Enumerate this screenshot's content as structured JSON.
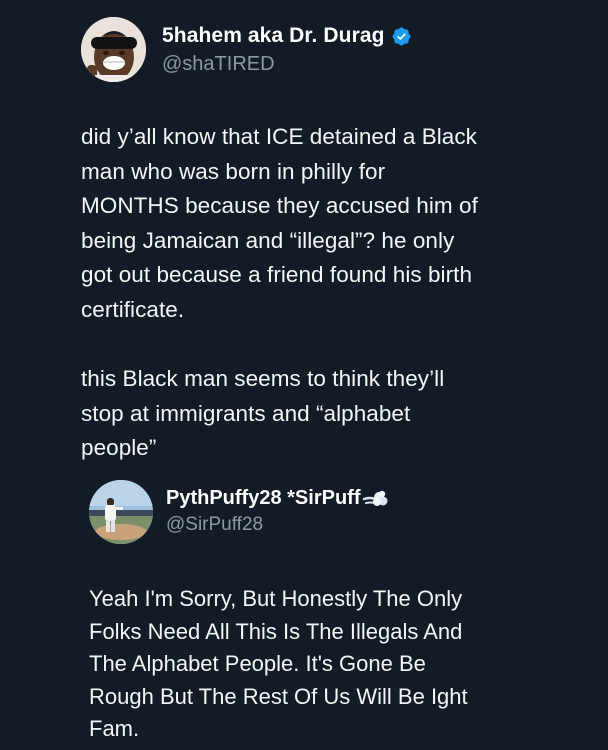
{
  "main_tweet": {
    "author_name": "5hahem aka Dr. Durag",
    "author_handle": "@shaTIRED",
    "verified": true,
    "paragraphs": [
      "did y’all know that ICE detained a Black\nman who was born in philly for\nMONTHS because they accused him of\nbeing Jamaican and “illegal”? he only\ngot out because a friend found his birth\ncertificate.",
      "this Black man seems to think they’ll\nstop at immigrants and “alphabet\npeople”"
    ]
  },
  "quoted_tweet": {
    "author_name": "PythPuffy28 *SirPuff",
    "author_handle": "@SirPuff28",
    "name_emoji": "dashing-away-icon",
    "text": "Yeah I'm Sorry, But Honestly The Only\nFolks Need All This Is The Illegals And\nThe Alphabet People. It's Gone Be\nRough But The Rest Of Us Will Be Ight\nFam."
  },
  "colors": {
    "background": "#131c26",
    "text": "#f4f6f8",
    "secondary_text": "#8b98a5",
    "verified_badge": "#1d9bf0"
  }
}
